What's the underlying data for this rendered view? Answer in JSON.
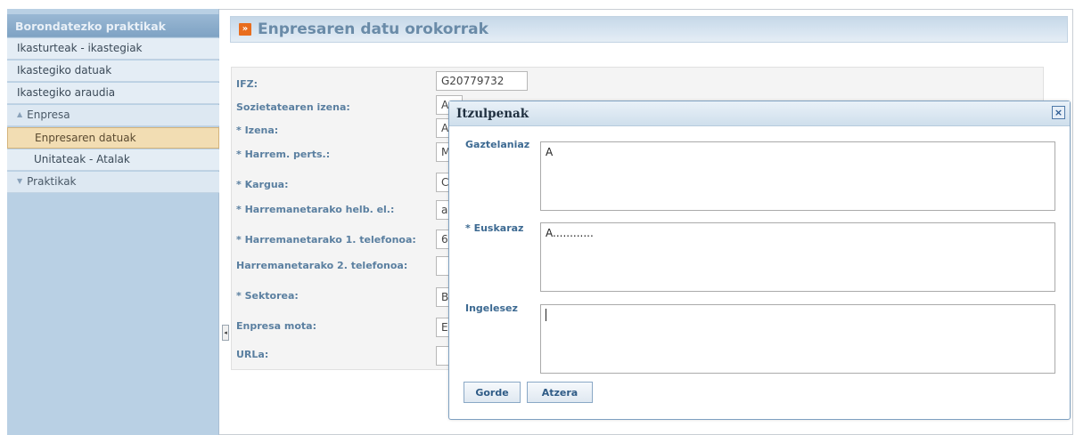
{
  "sidebar": {
    "header": "Borondatezko praktikak",
    "items": [
      {
        "label": "Ikasturteak - ikastegiak"
      },
      {
        "label": "Ikastegiko datuak"
      },
      {
        "label": "Ikastegiko araudia"
      },
      {
        "label": "Enpresa",
        "icon": "triangle-up-icon"
      },
      {
        "label": "Enpresaren datuak",
        "active": true
      },
      {
        "label": "Unitateak - Atalak"
      },
      {
        "label": "Praktikak",
        "icon": "triangle-down-icon"
      }
    ]
  },
  "header": {
    "title": "Enpresaren datu orokorrak",
    "badge": "»"
  },
  "form": {
    "fields": [
      {
        "label": "IFZ:",
        "value": "G20779732"
      },
      {
        "label": "Sozietatearen izena:",
        "value": "A"
      },
      {
        "label": "* Izena:",
        "value": "A"
      },
      {
        "label": "* Harrem. perts.:",
        "value": "M"
      },
      {
        "label": "* Kargua:",
        "value": "C"
      },
      {
        "label": "* Harremanetarako helb. el.:",
        "value": "a"
      },
      {
        "label": "* Harremanetarako 1. telefonoa:",
        "value": "6"
      },
      {
        "label": "Harremanetarako 2. telefonoa:",
        "value": ""
      },
      {
        "label": "* Sektorea:",
        "value": "B"
      },
      {
        "label": "Enpresa mota:",
        "value": "E"
      },
      {
        "label": "URLa:",
        "value": ""
      }
    ]
  },
  "modal": {
    "title": "Itzulpenak",
    "close": "×",
    "fields": [
      {
        "label": "Gaztelaniaz",
        "value": "A"
      },
      {
        "label": "* Euskaraz",
        "value": "A............"
      },
      {
        "label": "Ingelesez",
        "value": ""
      }
    ],
    "save_label": "Gorde",
    "back_label": "Atzera"
  },
  "collapse_glyph": "◂",
  "colors": {
    "accent": "#e86d1e",
    "sidebar": "#b9d0e4",
    "active_item": "#f2ddb3"
  }
}
